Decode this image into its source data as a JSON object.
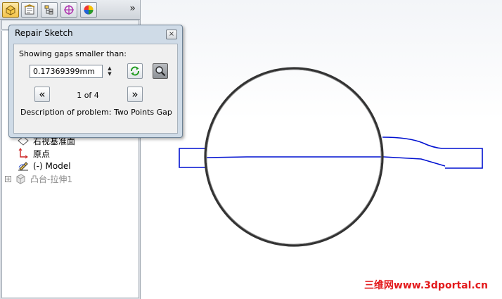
{
  "toolbar": {
    "tabs": [
      {
        "icon": "feature-manager-icon"
      },
      {
        "icon": "property-manager-icon"
      },
      {
        "icon": "configuration-manager-icon"
      },
      {
        "icon": "dimxpert-manager-icon"
      },
      {
        "icon": "display-manager-icon"
      }
    ],
    "more": "»"
  },
  "tree": {
    "items": [
      {
        "label": "右视基准面",
        "icon": "plane-icon"
      },
      {
        "label": "原点",
        "icon": "origin-icon"
      },
      {
        "label": "(-) Model",
        "icon": "sketch-icon"
      },
      {
        "label": "凸台-拉伸1",
        "icon": "extrude-icon",
        "expander": "+"
      }
    ]
  },
  "dialog": {
    "title": "Repair Sketch",
    "close": "×",
    "gap_label": "Showing gaps smaller than:",
    "gap_value": "0.17369399mm",
    "counter": "1 of 4",
    "prev": "«",
    "next": "»",
    "description": "Description of problem:  Two Points Gap"
  },
  "colors": {
    "sketch_line": "#0010d0",
    "circle": "#333333",
    "watermark": "#e3191b"
  },
  "watermark": "三维网www.3dportal.cn"
}
